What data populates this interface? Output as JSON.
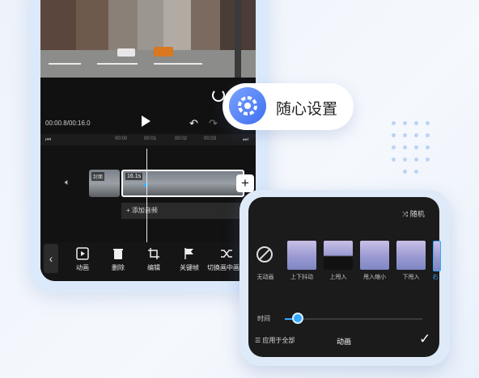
{
  "editor": {
    "timecode": "00:00.8/00:16.0",
    "ruler": [
      "00:00",
      "00:01",
      "00:02",
      "00:03"
    ],
    "clip_badge_1": "封面",
    "clip_badge_2": "16.1s",
    "add_audio": "+ 添加音频",
    "tools": [
      {
        "label": "动画",
        "icon": "animation-icon"
      },
      {
        "label": "删除",
        "icon": "trash-icon"
      },
      {
        "label": "编辑",
        "icon": "crop-icon"
      },
      {
        "label": "关键帧",
        "icon": "flag-icon"
      },
      {
        "label": "切换画中画",
        "icon": "shuffle-icon"
      }
    ]
  },
  "feature_pill": {
    "label": "随心设置",
    "icon": "gear-icon"
  },
  "panel": {
    "random_label": "随机",
    "presets": [
      {
        "label": "无动画",
        "icon": "none-icon"
      },
      {
        "label": "上下抖动"
      },
      {
        "label": "上甩入"
      },
      {
        "label": "甩入缩小"
      },
      {
        "label": "下甩入"
      },
      {
        "label": "右"
      }
    ],
    "time_label": "时间",
    "time_value_fraction": 0.08,
    "apply_all": "应用于全部",
    "title": "动画",
    "accent": "#35a8ff"
  }
}
